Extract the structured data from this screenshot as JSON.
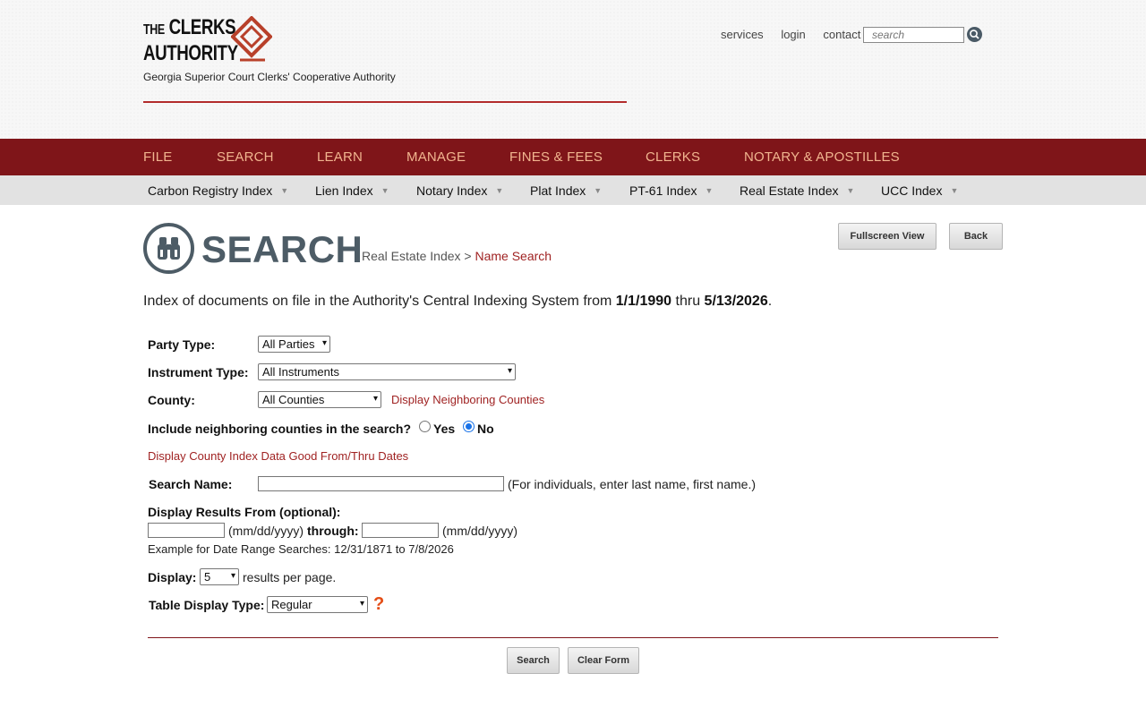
{
  "brand": {
    "logo_the": "THE",
    "logo_clerks": "CLERKS",
    "logo_authority": "AUTHORITY",
    "tagline": "Georgia Superior Court Clerks' Cooperative Authority",
    "accent_color": "#7f1519"
  },
  "utility": {
    "links": [
      "services",
      "login",
      "contact"
    ],
    "search_placeholder": "search"
  },
  "main_nav": [
    "FILE",
    "SEARCH",
    "LEARN",
    "MANAGE",
    "FINES & FEES",
    "CLERKS",
    "NOTARY & APOSTILLES"
  ],
  "sub_nav": [
    "Carbon Registry Index",
    "Lien Index",
    "Notary Index",
    "Plat Index",
    "PT-61 Index",
    "Real Estate Index",
    "UCC Index"
  ],
  "page": {
    "title": "SEARCH",
    "breadcrumb_parent": "Real Estate Index",
    "breadcrumb_sep": ">",
    "breadcrumb_current": "Name Search",
    "fullscreen_label": "Fullscreen View",
    "back_label": "Back",
    "intro_prefix": "Index of documents on file in the Authority's Central Indexing System from",
    "intro_from": "1/1/1990",
    "intro_mid": "thru",
    "intro_to": "5/13/2026",
    "intro_suffix": "."
  },
  "form": {
    "party_type_label": "Party Type:",
    "party_type_value": "All Parties",
    "instrument_type_label": "Instrument Type:",
    "instrument_type_value": "All Instruments",
    "county_label": "County:",
    "county_value": "All Counties",
    "neighboring_link": "Display Neighboring Counties",
    "include_neighbor_label": "Include neighboring counties in the search?",
    "yes_label": "Yes",
    "no_label": "No",
    "include_neighbor_value": "No",
    "county_dates_link": "Display County Index Data Good From/Thru Dates",
    "search_name_label": "Search Name:",
    "search_name_value": "",
    "search_name_hint": "(For individuals, enter last name, first name.)",
    "date_range_label": "Display Results From (optional):",
    "date_format": "(mm/dd/yyyy)",
    "through_label": "through:",
    "date_from_value": "",
    "date_to_value": "",
    "example_text": "Example for Date Range Searches: 12/31/1871 to 7/8/2026",
    "display_label": "Display:",
    "display_value": "5",
    "display_suffix": "results per page.",
    "table_type_label": "Table Display Type:",
    "table_type_value": "Regular",
    "help_glyph": "?",
    "search_button": "Search",
    "clear_button": "Clear Form"
  }
}
